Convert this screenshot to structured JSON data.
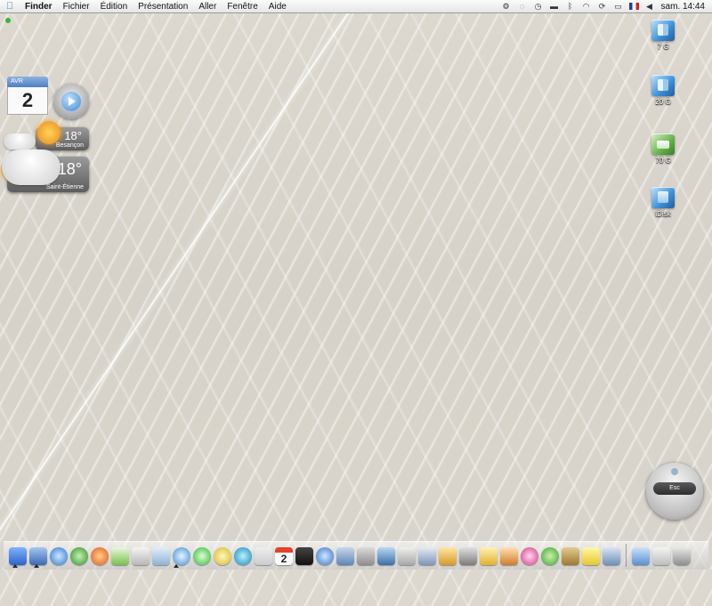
{
  "menubar": {
    "app": "Finder",
    "items": [
      "Fichier",
      "Édition",
      "Présentation",
      "Aller",
      "Fenêtre",
      "Aide"
    ],
    "clock": "sam. 14:44"
  },
  "desktop_icons": [
    {
      "label": "7 G",
      "icon": "external-drive-icon"
    },
    {
      "label": "20 G",
      "icon": "external-drive-icon"
    },
    {
      "label": "70 G",
      "icon": "home-drive-icon"
    },
    {
      "label": "iDisk",
      "icon": "idisk-icon"
    }
  ],
  "widgets": {
    "calendar": {
      "month": "AVR",
      "day": "2"
    },
    "weather_small": {
      "temp": "18°",
      "city": "Besançon"
    },
    "weather_large": {
      "temp": "18°",
      "city": "Saint-Étienne"
    }
  },
  "remote": {
    "esc_label": "Esc"
  },
  "dock": {
    "calendar_day": "2"
  },
  "colors": {
    "accent": "#3d8fd6",
    "menubar": "#eeeeee",
    "dock_bg": "#d8d8d8"
  }
}
